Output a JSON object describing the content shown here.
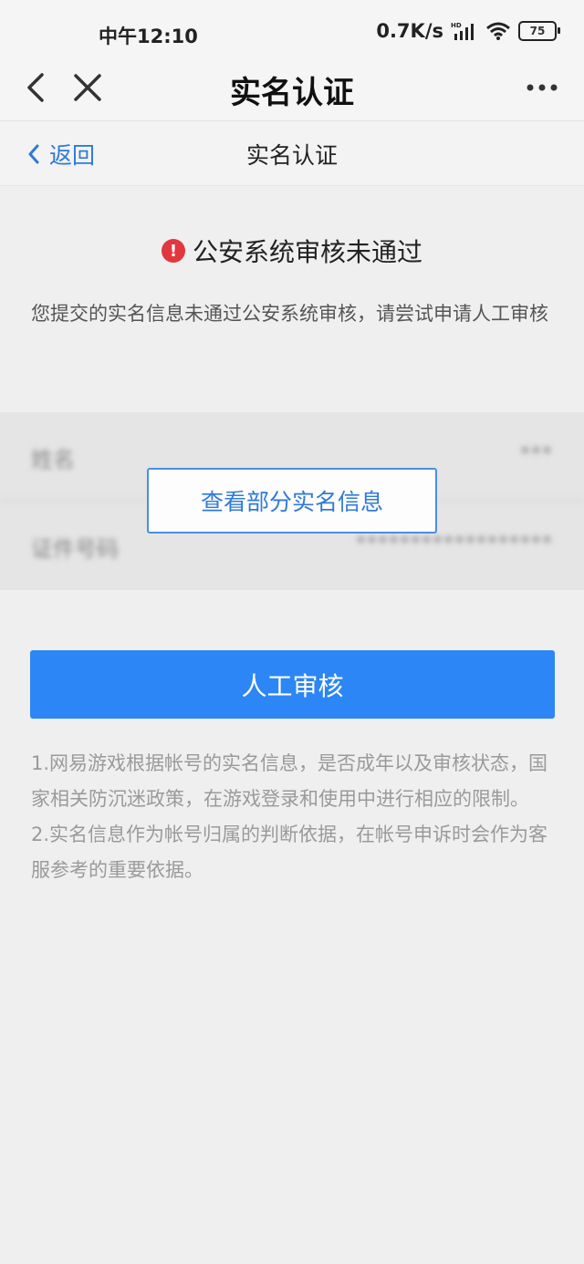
{
  "status_bar": {
    "time": "中午12:10",
    "net_speed": "0.7K/s",
    "battery": "75"
  },
  "titlebar": {
    "title": "实名认证"
  },
  "subheader": {
    "back_label": "返回",
    "title": "实名认证"
  },
  "error": {
    "title": "公安系统审核未通过",
    "description": "您提交的实名信息未通过公安系统审核，请尝试申请人工审核"
  },
  "info": {
    "name_label": "姓名",
    "name_value": "***",
    "id_label": "证件号码",
    "id_value": "******************",
    "view_button": "查看部分实名信息"
  },
  "primary_button": "人工审核",
  "notes": [
    "1.网易游戏根据帐号的实名信息，是否成年以及审核状态，国家相关防沉迷政策，在游戏登录和使用中进行相应的限制。",
    "2.实名信息作为帐号归属的判断依据，在帐号申诉时会作为客服参考的重要依据。"
  ],
  "colors": {
    "accent": "#2c86f5",
    "link": "#2f7ad8",
    "error": "#e0383e"
  }
}
